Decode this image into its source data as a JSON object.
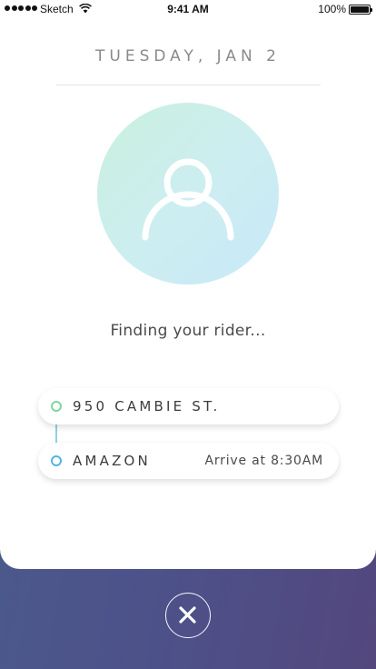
{
  "status_bar": {
    "carrier": "Sketch",
    "time": "9:41 AM",
    "battery": "100%",
    "battery_level": 1.0
  },
  "header": {
    "date": "TUESDAY, JAN 2"
  },
  "main": {
    "avatar_icon": "user-icon",
    "status_text": "Finding your rider..."
  },
  "route": {
    "origin": "950 CAMBIE ST.",
    "destination": "AMAZON",
    "arrival": "Arrive at 8:30AM"
  },
  "footer": {
    "close_icon": "close-icon"
  },
  "colors": {
    "origin_dot": "#7fd6a3",
    "destination_dot": "#4fb6df",
    "background_start": "#4a5c8c",
    "background_end": "#53477e"
  }
}
